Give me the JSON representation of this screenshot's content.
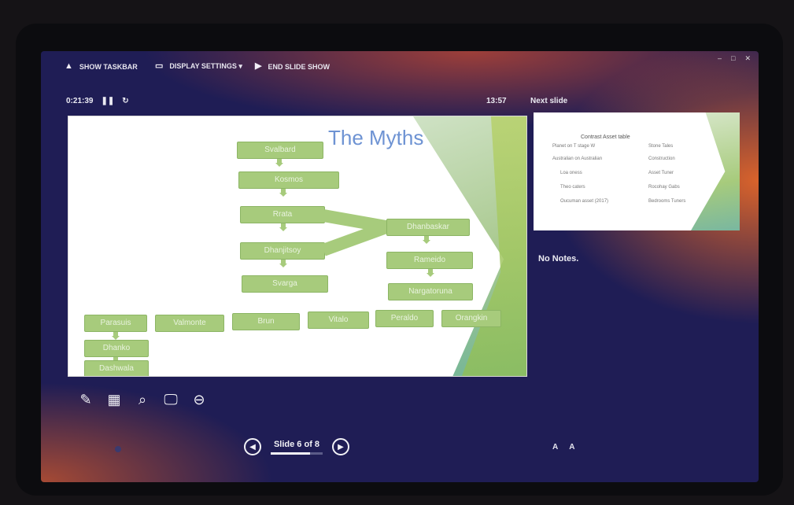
{
  "toolbar": {
    "items": [
      {
        "icon": "person-icon",
        "label": "SHOW TASKBAR"
      },
      {
        "icon": "display-icon",
        "label": "DISPLAY SETTINGS ▾"
      },
      {
        "icon": "end-show-icon",
        "label": "END SLIDE SHOW"
      }
    ]
  },
  "presenter": {
    "timer": "0:21:39",
    "pause_icon": "pause-icon",
    "restart_icon": "restart-icon",
    "clock": "13:57",
    "next_slide_label": "Next slide",
    "notes": "No Notes."
  },
  "current_slide": {
    "title": "The Myths",
    "boxes": [
      "Svalbard",
      "Kosmos",
      "Rrata",
      "Dhanjitsoy",
      "Svarga",
      "Dhanbaskar",
      "Rameido",
      "Nargatoruna",
      "Parasuis",
      "Valmonte",
      "Brun",
      "Vitalo",
      "Peraldo",
      "Orangkin",
      "Dhanko",
      "Dashwala"
    ]
  },
  "next_slide": {
    "title": "Contrast Asset table",
    "rows": [
      "Planet on T stage W",
      "Australian on Australian",
      "Loa oness",
      "Theo caters",
      "Oucuman asset (2017)"
    ],
    "right_rows": [
      "Stone Tales",
      "Construction",
      "Asset Tuner",
      "Rocohay Gabs",
      "Bedrooms Tuners"
    ]
  },
  "navigation": {
    "prev_icon": "chevron-left-icon",
    "next_icon": "chevron-right-icon",
    "slide_counter": "Slide 6 of 8",
    "progress_fraction": 0.75
  },
  "tools": [
    "pen-icon",
    "slide-grid-icon",
    "zoom-icon",
    "screen-icon",
    "subtitle-icon"
  ],
  "font_controls": [
    "A",
    "A"
  ]
}
